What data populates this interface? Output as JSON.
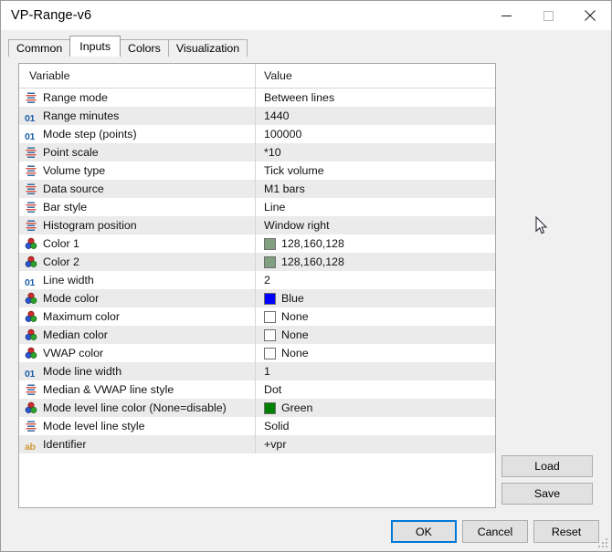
{
  "window": {
    "title": "VP-Range-v6",
    "controls": [
      {
        "name": "minimize",
        "glyph": "minimize-icon"
      },
      {
        "name": "maximize",
        "glyph": "maximize-icon"
      },
      {
        "name": "close",
        "glyph": "close-icon"
      }
    ]
  },
  "tabs": [
    {
      "label": "Common",
      "active": false
    },
    {
      "label": "Inputs",
      "active": true
    },
    {
      "label": "Colors",
      "active": false
    },
    {
      "label": "Visualization",
      "active": false
    }
  ],
  "table": {
    "headers": {
      "variable": "Variable",
      "value": "Value"
    },
    "rows": [
      {
        "icon": "enum",
        "variable": "Range mode",
        "value": "Between lines"
      },
      {
        "icon": "num",
        "variable": "Range minutes",
        "value": "1440"
      },
      {
        "icon": "num",
        "variable": "Mode step (points)",
        "value": "100000"
      },
      {
        "icon": "enum",
        "variable": "Point scale",
        "value": "*10"
      },
      {
        "icon": "enum",
        "variable": "Volume type",
        "value": "Tick volume"
      },
      {
        "icon": "enum",
        "variable": "Data source",
        "value": "M1 bars"
      },
      {
        "icon": "enum",
        "variable": "Bar style",
        "value": "Line"
      },
      {
        "icon": "enum",
        "variable": "Histogram position",
        "value": "Window right"
      },
      {
        "icon": "color",
        "variable": "Color  1",
        "value": "128,160,128",
        "swatch": "#80a080"
      },
      {
        "icon": "color",
        "variable": "Color  2",
        "value": "128,160,128",
        "swatch": "#80a080"
      },
      {
        "icon": "num",
        "variable": "Line width",
        "value": "2"
      },
      {
        "icon": "color",
        "variable": "Mode color",
        "value": "Blue",
        "swatch": "#0000ff"
      },
      {
        "icon": "color",
        "variable": "Maximum color",
        "value": "None",
        "swatch": "#ffffff"
      },
      {
        "icon": "color",
        "variable": "Median color",
        "value": "None",
        "swatch": "#ffffff"
      },
      {
        "icon": "color",
        "variable": "VWAP color",
        "value": "None",
        "swatch": "#ffffff"
      },
      {
        "icon": "num",
        "variable": "Mode line width",
        "value": "1"
      },
      {
        "icon": "enum",
        "variable": "Median & VWAP line style",
        "value": "Dot"
      },
      {
        "icon": "color",
        "variable": "Mode level line color (None=disable)",
        "value": "Green",
        "swatch": "#008000"
      },
      {
        "icon": "enum",
        "variable": "Mode level line style",
        "value": "Solid"
      },
      {
        "icon": "str",
        "variable": "Identifier",
        "value": "+vpr"
      }
    ]
  },
  "side_buttons": {
    "load": "Load",
    "save": "Save"
  },
  "bottom_buttons": {
    "ok": "OK",
    "cancel": "Cancel",
    "reset": "Reset"
  },
  "colors": {
    "accent": "#0078d7",
    "row_alt": "#ebebeb",
    "window_bg": "#f0f0f0",
    "icon_enum_red": "#d94f3d",
    "icon_enum_blue": "#2a6099",
    "icon_num_blue": "#1c5fa8",
    "icon_str_orange": "#d19a3c"
  }
}
